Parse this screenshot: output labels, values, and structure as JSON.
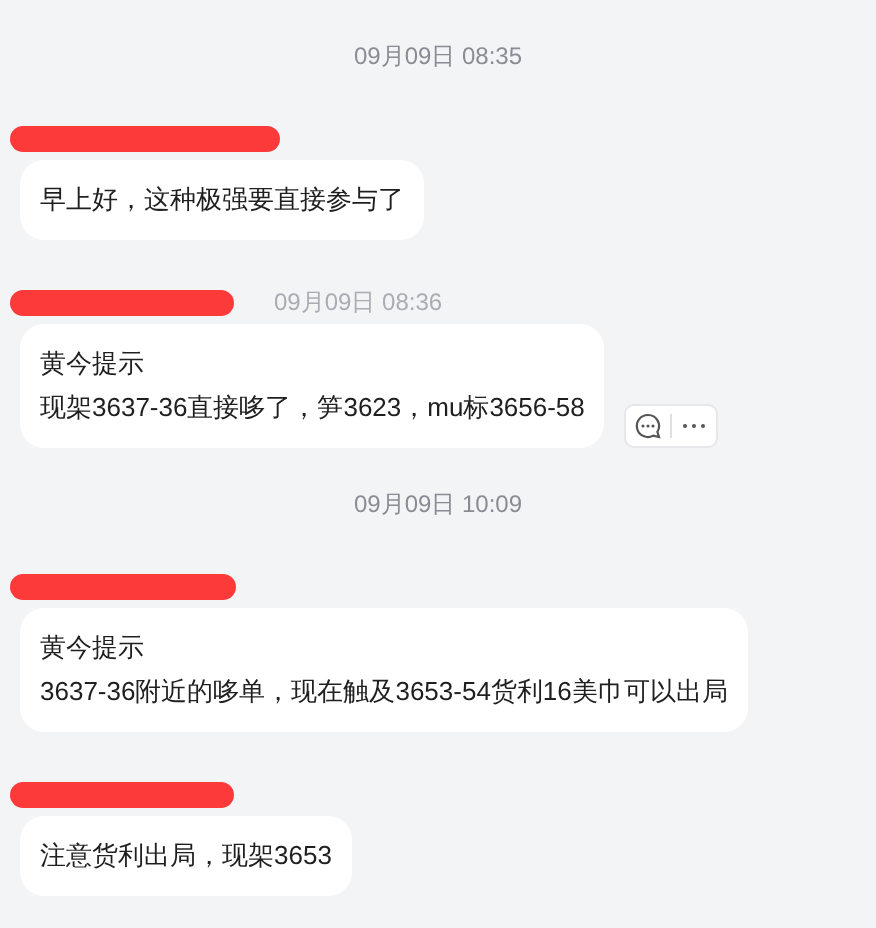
{
  "items": [
    {
      "kind": "time",
      "text": "09月09日 08:35"
    },
    {
      "kind": "message",
      "lines": [
        "早上好，这种极强要直接参与了"
      ],
      "actions": false
    },
    {
      "kind": "message",
      "time": "09月09日 08:36",
      "lines": [
        "黄今提示",
        "现架3637-36直接哆了，笋3623，mu标3656-58"
      ],
      "actions": true
    },
    {
      "kind": "time",
      "text": "09月09日 10:09"
    },
    {
      "kind": "message",
      "lines": [
        "黄今提示",
        "3637-36附近的哆单，现在触及3653-54货利16美巾可以出局"
      ],
      "actions": false
    },
    {
      "kind": "message",
      "lines": [
        "注意货利出局，现架3653"
      ],
      "actions": false
    }
  ]
}
